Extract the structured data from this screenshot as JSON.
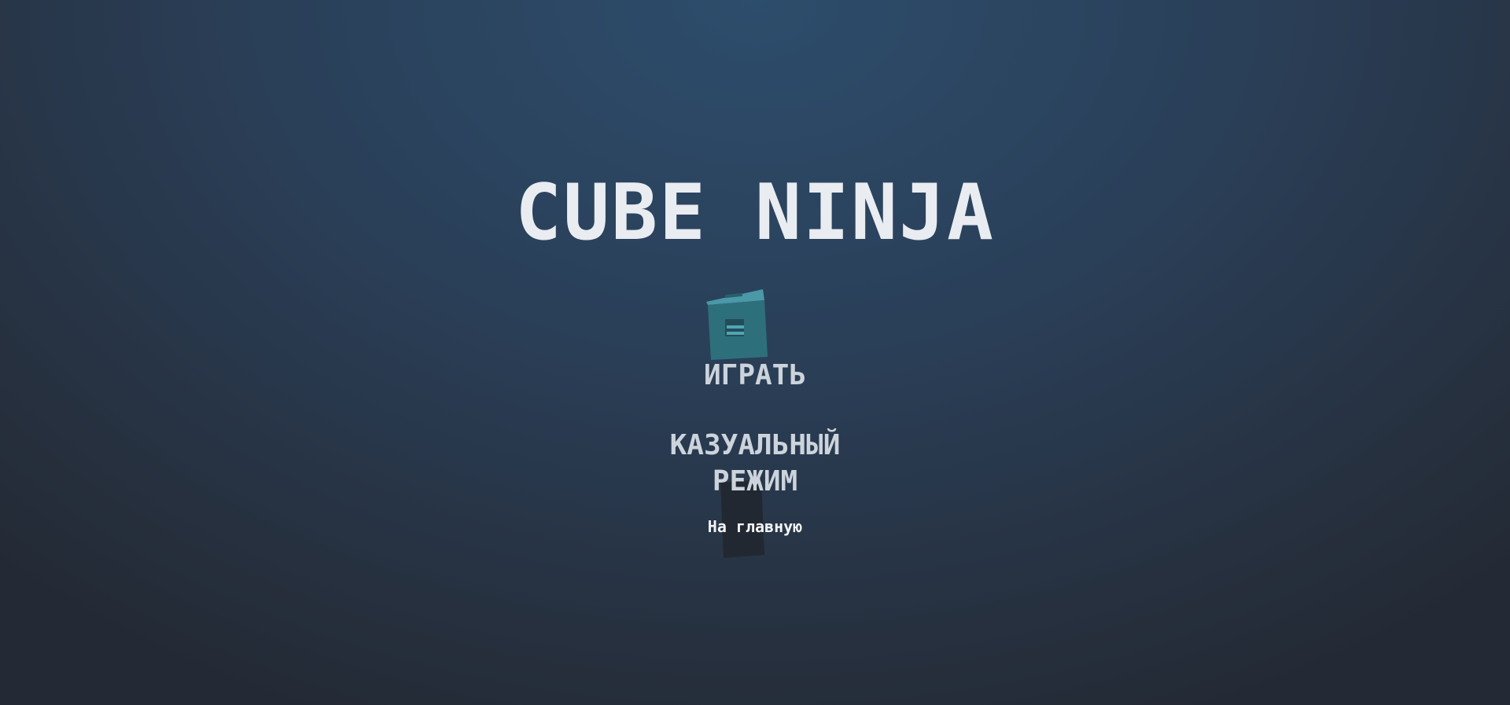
{
  "game": {
    "title": "CUBE NINJA"
  },
  "menu": {
    "play_label": "ИГРАТЬ",
    "casual_label_line1": "КАЗУАЛЬНЫЙ",
    "casual_label_line2": "РЕЖИМ",
    "home_label": "На главную"
  },
  "colors": {
    "background_center": "#2d4d6c",
    "background_edge": "#232a35",
    "title": "#e9ecf0",
    "menu_text": "#ccd3db",
    "teal_cube": "#2e6f7c",
    "dark_cube": "#222831"
  }
}
